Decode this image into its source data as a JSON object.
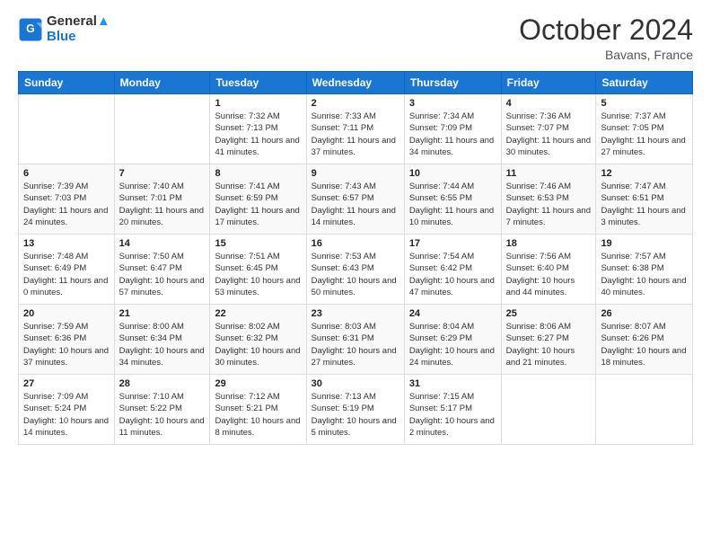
{
  "header": {
    "logo_line1": "General",
    "logo_line2": "Blue",
    "month_title": "October 2024",
    "location": "Bavans, France"
  },
  "columns": [
    "Sunday",
    "Monday",
    "Tuesday",
    "Wednesday",
    "Thursday",
    "Friday",
    "Saturday"
  ],
  "weeks": [
    [
      {
        "day": "",
        "info": ""
      },
      {
        "day": "",
        "info": ""
      },
      {
        "day": "1",
        "info": "Sunrise: 7:32 AM\nSunset: 7:13 PM\nDaylight: 11 hours and 41 minutes."
      },
      {
        "day": "2",
        "info": "Sunrise: 7:33 AM\nSunset: 7:11 PM\nDaylight: 11 hours and 37 minutes."
      },
      {
        "day": "3",
        "info": "Sunrise: 7:34 AM\nSunset: 7:09 PM\nDaylight: 11 hours and 34 minutes."
      },
      {
        "day": "4",
        "info": "Sunrise: 7:36 AM\nSunset: 7:07 PM\nDaylight: 11 hours and 30 minutes."
      },
      {
        "day": "5",
        "info": "Sunrise: 7:37 AM\nSunset: 7:05 PM\nDaylight: 11 hours and 27 minutes."
      }
    ],
    [
      {
        "day": "6",
        "info": "Sunrise: 7:39 AM\nSunset: 7:03 PM\nDaylight: 11 hours and 24 minutes."
      },
      {
        "day": "7",
        "info": "Sunrise: 7:40 AM\nSunset: 7:01 PM\nDaylight: 11 hours and 20 minutes."
      },
      {
        "day": "8",
        "info": "Sunrise: 7:41 AM\nSunset: 6:59 PM\nDaylight: 11 hours and 17 minutes."
      },
      {
        "day": "9",
        "info": "Sunrise: 7:43 AM\nSunset: 6:57 PM\nDaylight: 11 hours and 14 minutes."
      },
      {
        "day": "10",
        "info": "Sunrise: 7:44 AM\nSunset: 6:55 PM\nDaylight: 11 hours and 10 minutes."
      },
      {
        "day": "11",
        "info": "Sunrise: 7:46 AM\nSunset: 6:53 PM\nDaylight: 11 hours and 7 minutes."
      },
      {
        "day": "12",
        "info": "Sunrise: 7:47 AM\nSunset: 6:51 PM\nDaylight: 11 hours and 3 minutes."
      }
    ],
    [
      {
        "day": "13",
        "info": "Sunrise: 7:48 AM\nSunset: 6:49 PM\nDaylight: 11 hours and 0 minutes."
      },
      {
        "day": "14",
        "info": "Sunrise: 7:50 AM\nSunset: 6:47 PM\nDaylight: 10 hours and 57 minutes."
      },
      {
        "day": "15",
        "info": "Sunrise: 7:51 AM\nSunset: 6:45 PM\nDaylight: 10 hours and 53 minutes."
      },
      {
        "day": "16",
        "info": "Sunrise: 7:53 AM\nSunset: 6:43 PM\nDaylight: 10 hours and 50 minutes."
      },
      {
        "day": "17",
        "info": "Sunrise: 7:54 AM\nSunset: 6:42 PM\nDaylight: 10 hours and 47 minutes."
      },
      {
        "day": "18",
        "info": "Sunrise: 7:56 AM\nSunset: 6:40 PM\nDaylight: 10 hours and 44 minutes."
      },
      {
        "day": "19",
        "info": "Sunrise: 7:57 AM\nSunset: 6:38 PM\nDaylight: 10 hours and 40 minutes."
      }
    ],
    [
      {
        "day": "20",
        "info": "Sunrise: 7:59 AM\nSunset: 6:36 PM\nDaylight: 10 hours and 37 minutes."
      },
      {
        "day": "21",
        "info": "Sunrise: 8:00 AM\nSunset: 6:34 PM\nDaylight: 10 hours and 34 minutes."
      },
      {
        "day": "22",
        "info": "Sunrise: 8:02 AM\nSunset: 6:32 PM\nDaylight: 10 hours and 30 minutes."
      },
      {
        "day": "23",
        "info": "Sunrise: 8:03 AM\nSunset: 6:31 PM\nDaylight: 10 hours and 27 minutes."
      },
      {
        "day": "24",
        "info": "Sunrise: 8:04 AM\nSunset: 6:29 PM\nDaylight: 10 hours and 24 minutes."
      },
      {
        "day": "25",
        "info": "Sunrise: 8:06 AM\nSunset: 6:27 PM\nDaylight: 10 hours and 21 minutes."
      },
      {
        "day": "26",
        "info": "Sunrise: 8:07 AM\nSunset: 6:26 PM\nDaylight: 10 hours and 18 minutes."
      }
    ],
    [
      {
        "day": "27",
        "info": "Sunrise: 7:09 AM\nSunset: 5:24 PM\nDaylight: 10 hours and 14 minutes."
      },
      {
        "day": "28",
        "info": "Sunrise: 7:10 AM\nSunset: 5:22 PM\nDaylight: 10 hours and 11 minutes."
      },
      {
        "day": "29",
        "info": "Sunrise: 7:12 AM\nSunset: 5:21 PM\nDaylight: 10 hours and 8 minutes."
      },
      {
        "day": "30",
        "info": "Sunrise: 7:13 AM\nSunset: 5:19 PM\nDaylight: 10 hours and 5 minutes."
      },
      {
        "day": "31",
        "info": "Sunrise: 7:15 AM\nSunset: 5:17 PM\nDaylight: 10 hours and 2 minutes."
      },
      {
        "day": "",
        "info": ""
      },
      {
        "day": "",
        "info": ""
      }
    ]
  ]
}
